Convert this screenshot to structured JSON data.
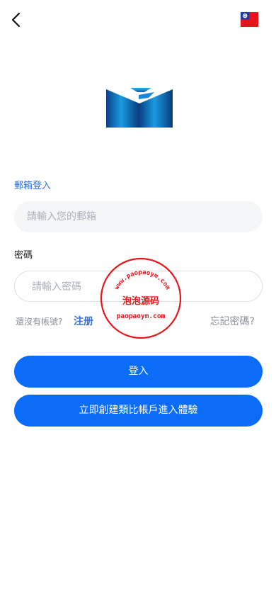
{
  "header": {
    "back_icon": "chevron-left-icon",
    "flag_icon": "taiwan-flag-icon"
  },
  "form": {
    "email_label": "郵箱登入",
    "email_placeholder": "請輸入您的郵箱",
    "password_label": "密碼",
    "password_placeholder": "請輸入密碼"
  },
  "links": {
    "no_account": "還沒有帳號?",
    "register": "注册",
    "forgot": "忘記密碼?"
  },
  "buttons": {
    "login": "登入",
    "demo": "立即創建類比帳戶進入體驗"
  },
  "watermark": {
    "top_text": "www.paopaoym.com",
    "middle_text": "泡泡源码",
    "bottom_text": "paopaoym.com"
  },
  "colors": {
    "primary": "#0b6cf8",
    "link": "#3b6fd6",
    "watermark": "#e8161b"
  }
}
